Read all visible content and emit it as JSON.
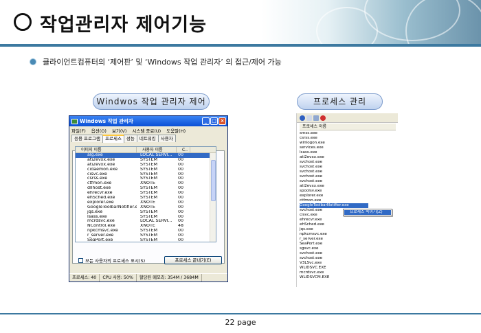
{
  "title": "작업관리자 제어기능",
  "bullet": "클라이언트컴퓨터의 ‘제어판’ 및 ‘Windows 작업 관리자’ 의 접근/제어 가능",
  "labels": {
    "left": "Windwos 작업 관리자 제어",
    "right": "프로세스 관리"
  },
  "taskmgr": {
    "title": "Windows 작업 관리자",
    "menu": [
      "파일(F)",
      "옵션(O)",
      "보기(V)",
      "시스템 종료(U)",
      "도움말(H)"
    ],
    "tabs": [
      "응용 프로그램",
      "프로세스",
      "성능",
      "네트워킹",
      "사용자"
    ],
    "active_tab": 1,
    "columns": [
      "이미지 이름",
      "사용자 이름",
      "C.."
    ],
    "rows": [
      [
        "alg.exe",
        "LOCAL SERVI...",
        "00"
      ],
      [
        "ati2evxx.exe",
        "SYSTEM",
        "00"
      ],
      [
        "ati2evxx.exe",
        "SYSTEM",
        "00"
      ],
      [
        "cidaemon.exe",
        "SYSTEM",
        "00"
      ],
      [
        "cisvc.exe",
        "SYSTEM",
        "00"
      ],
      [
        "csrss.exe",
        "SYSTEM",
        "00"
      ],
      [
        "ctfmon.exe",
        "XNOTE",
        "00"
      ],
      [
        "dllhost.exe",
        "SYSTEM",
        "00"
      ],
      [
        "ehrecvr.exe",
        "SYSTEM",
        "00"
      ],
      [
        "ehSched.exe",
        "SYSTEM",
        "00"
      ],
      [
        "explorer.exe",
        "XNOTE",
        "00"
      ],
      [
        "GoogleToolbarNotifier.exe",
        "XNOTE",
        "00"
      ],
      [
        "jqs.exe",
        "SYSTEM",
        "00"
      ],
      [
        "lsass.exe",
        "SYSTEM",
        "00"
      ],
      [
        "mcrdsvc.exe",
        "LOCAL SERVI...",
        "00"
      ],
      [
        "NControl.exe",
        "XNOTE",
        "48"
      ],
      [
        "npkcmsvc.exe",
        "SYSTEM",
        "00"
      ],
      [
        "r_server.exe",
        "SYSTEM",
        "00"
      ],
      [
        "SeaPort.exe",
        "SYSTEM",
        "00"
      ],
      [
        "services.exe",
        "SYSTEM",
        "00"
      ]
    ],
    "selected_row": 0,
    "show_all_users": "모든 사용자의 프로세스 표시(S)",
    "end_process": "프로세스 끝내기(E)",
    "status": [
      "프로세스: 40",
      "CPU 사용: 50%",
      "할당된 메모리: 354M / 3684M"
    ]
  },
  "procexp": {
    "column": "프로세스 이름",
    "items": [
      "smss.exe",
      "csrss.exe",
      "winlogon.exe",
      "services.exe",
      "lsass.exe",
      "ati2evxx.exe",
      "svchost.exe",
      "svchost.exe",
      "svchost.exe",
      "svchost.exe",
      "svchost.exe",
      "ati2evxx.exe",
      "spoolsv.exe",
      "explorer.exe",
      "ctfmon.exe",
      "GoogleToolbarNotifier.exe",
      "svchost.exe",
      "cisvc.exe",
      "ehrecvr.exe",
      "ehSched.exe",
      "jqs.exe",
      "npkcmsvc.exe",
      "r_server.exe",
      "SeaPort.exe",
      "sgsvc.exe",
      "svchost.exe",
      "svchost.exe",
      "V3LSvc.exe",
      "WLIDSVC.EXE",
      "mcrdsvc.exe",
      "WLIDSVCM.EXE"
    ],
    "selected_index": 15,
    "context_item": "프로세스 죽이기(Z)"
  },
  "footer": "22 page"
}
